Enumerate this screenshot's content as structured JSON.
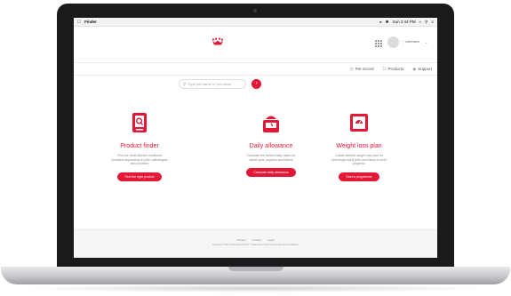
{
  "menubar": {
    "app_name": "Finder",
    "time": "Sun 2:44 PM"
  },
  "header": {
    "user_name": "~ Username"
  },
  "nav": {
    "items": [
      {
        "label": "Pet record"
      },
      {
        "label": "Products"
      },
      {
        "label": "Support"
      }
    ]
  },
  "search": {
    "placeholder": "Type pet name or pet name"
  },
  "cards": [
    {
      "title": "Product finder",
      "desc": "Find the most tailored nutritional solutions depending on pets' pathologies and condition",
      "button": "Find the right product"
    },
    {
      "title": "Daily allowance",
      "desc": "Calculate the perfect daily ration for adults pets, puppies and kittens",
      "button": "Calculate daily allowance"
    },
    {
      "title": "Weight loss plan",
      "desc": "Create tailored weight loss plan for overweight adult pets and follow on their progress",
      "button": "Start a programme"
    }
  ],
  "footer": {
    "links": [
      "Privacy",
      "Cookies",
      "Legal"
    ],
    "copyright": "Copyright © Mars 2019 Royal Canin®. Trademark of Mars Incorporated and its affiliates."
  },
  "colors": {
    "accent": "#e31837"
  }
}
